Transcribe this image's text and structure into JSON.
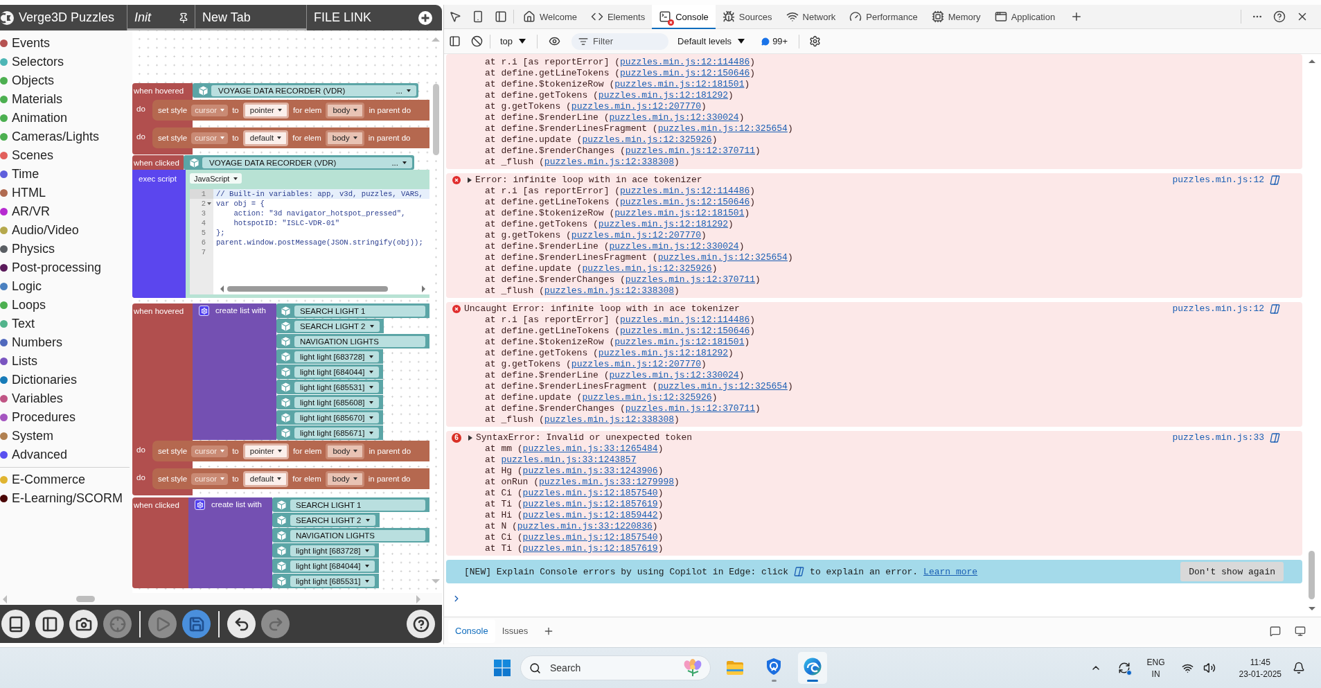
{
  "puzzles": {
    "title": "Verge3D Puzzles",
    "tabs": [
      {
        "label": "Init",
        "italic": true,
        "pinned": true,
        "underlined": true
      },
      {
        "label": "New Tab",
        "italic": false,
        "pinned": false,
        "underlined": true
      },
      {
        "label": "FILE LINK",
        "italic": false,
        "pinned": false,
        "underlined": false
      }
    ],
    "categories": [
      {
        "label": "Events",
        "color": "#b55251"
      },
      {
        "label": "Selectors",
        "color": "#4db6b5"
      },
      {
        "label": "Objects",
        "color": "#4caf50"
      },
      {
        "label": "Materials",
        "color": "#4caf50"
      },
      {
        "label": "Animation",
        "color": "#4caf50"
      },
      {
        "label": "Cameras/Lights",
        "color": "#4caf50"
      },
      {
        "label": "Scenes",
        "color": "#e2605c"
      },
      {
        "label": "Time",
        "color": "#5f5fdc"
      },
      {
        "label": "HTML",
        "color": "#b06b50"
      },
      {
        "label": "AR/VR",
        "color": "#b62ad0"
      },
      {
        "label": "Audio/Video",
        "color": "#b5a84c"
      },
      {
        "label": "Physics",
        "color": "#5a5e63"
      },
      {
        "label": "Post-processing",
        "color": "#5a1a5a"
      },
      {
        "label": "Logic",
        "color": "#4a80c0"
      },
      {
        "label": "Loops",
        "color": "#4caf50"
      },
      {
        "label": "Text",
        "color": "#52b48c"
      },
      {
        "label": "Numbers",
        "color": "#5069bd"
      },
      {
        "label": "Lists",
        "color": "#7a55c0"
      },
      {
        "label": "Dictionaries",
        "color": "#177bb8"
      },
      {
        "label": "Variables",
        "color": "#c05585"
      },
      {
        "label": "Procedures",
        "color": "#a455c0"
      },
      {
        "label": "System",
        "color": "#b08050"
      },
      {
        "label": "Advanced",
        "color": "#5a50f0"
      }
    ],
    "extra_categories": [
      {
        "label": "E-Commerce",
        "color": "#e0b430"
      },
      {
        "label": "E-Learning/SCORM",
        "color": "#4a0606"
      }
    ],
    "workspace": {
      "groups": [
        {
          "kind": "hover_style",
          "event": "when hovered",
          "object": {
            "label": "VOYAGE DATA RECORDER (VDR)",
            "more": "..."
          },
          "branches": [
            {
              "label": "do",
              "action": {
                "verb": "set style",
                "property": "cursor",
                "to": "to",
                "value": "pointer",
                "for": "for elem",
                "element": "body",
                "tail": "in parent do"
              }
            },
            {
              "label": "do",
              "action": {
                "verb": "set style",
                "property": "cursor",
                "to": "to",
                "value": "default",
                "for": "for elem",
                "element": "body",
                "tail": "in parent do"
              }
            }
          ]
        },
        {
          "kind": "click_script",
          "event": "when clicked",
          "object": {
            "label": "VOYAGE DATA RECORDER (VDR)",
            "more": "..."
          },
          "script": {
            "label": "exec script",
            "language": "JavaScript",
            "lines": [
              {
                "num": "1",
                "text": "// Built-in variables: app, v3d, puzzles, VARS,",
                "active": true,
                "fold": false
              },
              {
                "num": "2",
                "text": "var obj = {",
                "active": false,
                "fold": true
              },
              {
                "num": "3",
                "text": "    action: \"3d navigator_hotspot_pressed\",",
                "active": false,
                "fold": false
              },
              {
                "num": "4",
                "text": "    hotspotID: \"ISLC-VDR-01\"",
                "active": false,
                "fold": false
              },
              {
                "num": "5",
                "text": "};",
                "active": false,
                "fold": false
              },
              {
                "num": "6",
                "text": "parent.window.postMessage(JSON.stringify(obj));",
                "active": false,
                "fold": false
              },
              {
                "num": "7",
                "active": false,
                "fold": false
              }
            ]
          }
        },
        {
          "kind": "hover_list",
          "event": "when hovered",
          "list": {
            "label": "create list with",
            "items": [
              {
                "label": "SEARCH LIGHT 1",
                "dropdown": false
              },
              {
                "label": "SEARCH LIGHT 2",
                "dropdown": true
              },
              {
                "label": "NAVIGATION LIGHTS",
                "dropdown": false
              },
              {
                "label": "light light [683728]",
                "dropdown": true
              },
              {
                "label": "light light [684044]",
                "dropdown": true
              },
              {
                "label": "light light [685531]",
                "dropdown": true
              },
              {
                "label": "light light [685608]",
                "dropdown": true
              },
              {
                "label": "light light [685670]",
                "dropdown": true
              },
              {
                "label": "light light [685671]",
                "dropdown": true
              }
            ]
          },
          "branches": [
            {
              "label": "do",
              "action": {
                "verb": "set style",
                "property": "cursor",
                "to": "to",
                "value": "pointer",
                "for": "for elem",
                "element": "body",
                "tail": "in parent do"
              }
            },
            {
              "label": "do",
              "action": {
                "verb": "set style",
                "property": "cursor",
                "to": "to",
                "value": "default",
                "for": "for elem",
                "element": "body",
                "tail": "in parent do"
              }
            }
          ]
        },
        {
          "kind": "click_list",
          "event": "when clicked",
          "list": {
            "label": "create list with",
            "items": [
              {
                "label": "SEARCH LIGHT 1",
                "dropdown": false
              },
              {
                "label": "SEARCH LIGHT 2",
                "dropdown": true
              },
              {
                "label": "NAVIGATION LIGHTS",
                "dropdown": false
              },
              {
                "label": "light light [683728]",
                "dropdown": true
              },
              {
                "label": "light light [684044]",
                "dropdown": true
              },
              {
                "label": "light light [685531]",
                "dropdown": true
              }
            ]
          }
        }
      ]
    },
    "toolbar": {
      "groups": [
        [
          {
            "kind": "manual",
            "disabled": false,
            "highlighted": false
          },
          {
            "kind": "panel",
            "disabled": false,
            "highlighted": false
          },
          {
            "kind": "screenshot",
            "disabled": false,
            "highlighted": false
          },
          {
            "kind": "center",
            "disabled": true,
            "highlighted": false
          }
        ],
        [
          {
            "kind": "run",
            "disabled": true,
            "highlighted": false
          },
          {
            "kind": "save",
            "disabled": false,
            "highlighted": true
          }
        ],
        [
          {
            "kind": "undo",
            "disabled": false,
            "highlighted": false
          },
          {
            "kind": "redo",
            "disabled": true,
            "highlighted": false
          }
        ]
      ],
      "end": [
        {
          "kind": "help",
          "disabled": false,
          "highlighted": false
        }
      ]
    }
  },
  "devtools": {
    "tabs": [
      {
        "kind": "welcome",
        "label": "Welcome",
        "selected": false,
        "badge": false
      },
      {
        "kind": "elements",
        "label": "Elements",
        "selected": false,
        "badge": false
      },
      {
        "kind": "console",
        "label": "Console",
        "selected": true,
        "badge": true
      },
      {
        "kind": "sources",
        "label": "Sources",
        "selected": false,
        "badge": false
      },
      {
        "kind": "network",
        "label": "Network",
        "selected": false,
        "badge": false
      },
      {
        "kind": "performance",
        "label": "Performance",
        "selected": false,
        "badge": false
      },
      {
        "kind": "memory",
        "label": "Memory",
        "selected": false,
        "badge": false
      },
      {
        "kind": "application",
        "label": "Application",
        "selected": false,
        "badge": false
      }
    ],
    "toolbar": {
      "context": "top",
      "filter": {
        "placeholder": "Filter"
      },
      "levels": "Default levels",
      "issues": "99+"
    },
    "messages": [
      {
        "kind": "error",
        "stack": [
          {
            "before": "at r.i [as reportError] (",
            "link": "puzzles.min.js:12:114486",
            "after": ")"
          },
          {
            "before": "at define.getLineTokens (",
            "link": "puzzles.min.js:12:150646",
            "after": ")"
          },
          {
            "before": "at define.$tokenizeRow (",
            "link": "puzzles.min.js:12:181501",
            "after": ")"
          },
          {
            "before": "at define.getTokens (",
            "link": "puzzles.min.js:12:181292",
            "after": ")"
          },
          {
            "before": "at g.getTokens (",
            "link": "puzzles.min.js:12:207770",
            "after": ")"
          },
          {
            "before": "at define.$renderLine (",
            "link": "puzzles.min.js:12:330024",
            "after": ")"
          },
          {
            "before": "at define.$renderLinesFragment (",
            "link": "puzzles.min.js:12:325654",
            "after": ")"
          },
          {
            "before": "at define.update (",
            "link": "puzzles.min.js:12:325926",
            "after": ")"
          },
          {
            "before": "at define.$renderChanges (",
            "link": "puzzles.min.js:12:370711",
            "after": ")"
          },
          {
            "before": "at _flush (",
            "link": "puzzles.min.js:12:338308",
            "after": ")"
          }
        ]
      },
      {
        "kind": "error",
        "expandable": true,
        "text": "Error: infinite loop with in ace tokenizer",
        "source": "puzzles.min.js:12",
        "stack": [
          {
            "before": "at r.i [as reportError] (",
            "link": "puzzles.min.js:12:114486",
            "after": ")"
          },
          {
            "before": "at define.getLineTokens (",
            "link": "puzzles.min.js:12:150646",
            "after": ")"
          },
          {
            "before": "at define.$tokenizeRow (",
            "link": "puzzles.min.js:12:181501",
            "after": ")"
          },
          {
            "before": "at define.getTokens (",
            "link": "puzzles.min.js:12:181292",
            "after": ")"
          },
          {
            "before": "at g.getTokens (",
            "link": "puzzles.min.js:12:207770",
            "after": ")"
          },
          {
            "before": "at define.$renderLine (",
            "link": "puzzles.min.js:12:330024",
            "after": ")"
          },
          {
            "before": "at define.$renderLinesFragment (",
            "link": "puzzles.min.js:12:325654",
            "after": ")"
          },
          {
            "before": "at define.update (",
            "link": "puzzles.min.js:12:325926",
            "after": ")"
          },
          {
            "before": "at define.$renderChanges (",
            "link": "puzzles.min.js:12:370711",
            "after": ")"
          },
          {
            "before": "at _flush (",
            "link": "puzzles.min.js:12:338308",
            "after": ")"
          }
        ]
      },
      {
        "kind": "error",
        "expandable": false,
        "text": "Uncaught Error: infinite loop with in ace tokenizer",
        "source": "puzzles.min.js:12",
        "stack": [
          {
            "before": "at r.i [as reportError] (",
            "link": "puzzles.min.js:12:114486",
            "after": ")"
          },
          {
            "before": "at define.getLineTokens (",
            "link": "puzzles.min.js:12:150646",
            "after": ")"
          },
          {
            "before": "at define.$tokenizeRow (",
            "link": "puzzles.min.js:12:181501",
            "after": ")"
          },
          {
            "before": "at define.getTokens (",
            "link": "puzzles.min.js:12:181292",
            "after": ")"
          },
          {
            "before": "at g.getTokens (",
            "link": "puzzles.min.js:12:207770",
            "after": ")"
          },
          {
            "before": "at define.$renderLine (",
            "link": "puzzles.min.js:12:330024",
            "after": ")"
          },
          {
            "before": "at define.$renderLinesFragment (",
            "link": "puzzles.min.js:12:325654",
            "after": ")"
          },
          {
            "before": "at define.update (",
            "link": "puzzles.min.js:12:325926",
            "after": ")"
          },
          {
            "before": "at define.$renderChanges (",
            "link": "puzzles.min.js:12:370711",
            "after": ")"
          },
          {
            "before": "at _flush (",
            "link": "puzzles.min.js:12:338308",
            "after": ")"
          }
        ]
      },
      {
        "kind": "error",
        "count": "6",
        "expandable": true,
        "text": "SyntaxError: Invalid or unexpected token",
        "source": "puzzles.min.js:33",
        "stack": [
          {
            "before": "at mm (",
            "link": "puzzles.min.js:33:1265484",
            "after": ")"
          },
          {
            "before": "at ",
            "link": "puzzles.min.js:33:1243857"
          },
          {
            "before": "at Hg (",
            "link": "puzzles.min.js:33:1243906",
            "after": ")"
          },
          {
            "before": "at onRun (",
            "link": "puzzles.min.js:33:1279998",
            "after": ")"
          },
          {
            "before": "at Ci (",
            "link": "puzzles.min.js:12:1857540",
            "after": ")"
          },
          {
            "before": "at Ti (",
            "link": "puzzles.min.js:12:1857619",
            "after": ")"
          },
          {
            "before": "at Hi (",
            "link": "puzzles.min.js:12:1859442",
            "after": ")"
          },
          {
            "before": "at N (",
            "link": "puzzles.min.js:33:1220836",
            "after": ")"
          },
          {
            "before": "at Ci (",
            "link": "puzzles.min.js:12:1857540",
            "after": ")"
          },
          {
            "before": "at Ti (",
            "link": "puzzles.min.js:12:1857619",
            "after": ")"
          }
        ]
      }
    ],
    "banner": {
      "text": "[NEW] Explain Console errors by using Copilot in Edge: click",
      "text_after_icon": "to explain an error.",
      "link": "Learn more",
      "button": "Don't show again"
    },
    "drawer_tabs": [
      {
        "label": "Console",
        "selected": true
      },
      {
        "label": "Issues",
        "selected": false
      }
    ]
  },
  "taskbar": {
    "search": {
      "label": "Search"
    },
    "apps": [
      {
        "kind": "files",
        "running": false,
        "active": false
      },
      {
        "kind": "shield",
        "running": true,
        "active": false
      },
      {
        "kind": "browser",
        "running": true,
        "active": true
      }
    ],
    "tray": {
      "language": "ENG",
      "region": "IN",
      "time": "11:45",
      "date": "23-01-2025"
    }
  }
}
